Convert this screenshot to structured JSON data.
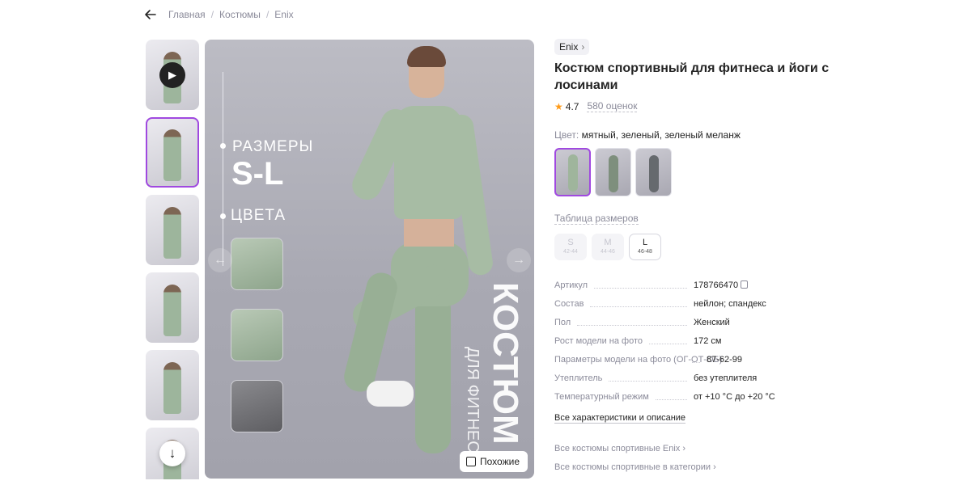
{
  "breadcrumbs": [
    "Главная",
    "Костюмы",
    "Enix"
  ],
  "gallery": {
    "hero_texts": {
      "sizes_label": "РАЗМЕРЫ",
      "sizes_value": "S-L",
      "colors_label": "ЦВЕТА",
      "vertical_big": "КОСТЮМ",
      "vertical_small": "ДЛЯ ФИТНЕС"
    },
    "similar_label": "Похожие"
  },
  "product": {
    "brand": "Enix",
    "title": "Костюм спортивный для фитнеса и йоги с лосинами",
    "rating": "4.7",
    "reviews": "580 оценок",
    "color_key": "Цвет:",
    "color_value": "мятный, зеленый, зеленый меланж",
    "size_table_link": "Таблица размеров",
    "sizes": [
      {
        "size": "S",
        "range": "42-44",
        "available": false
      },
      {
        "size": "M",
        "range": "44-46",
        "available": false
      },
      {
        "size": "L",
        "range": "46-48",
        "available": true
      }
    ],
    "specs": [
      {
        "key": "Артикул",
        "value": "178766470"
      },
      {
        "key": "Состав",
        "value": "нейлон; спандекс"
      },
      {
        "key": "Пол",
        "value": "Женский"
      },
      {
        "key": "Рост модели на фото",
        "value": "172 см"
      },
      {
        "key": "Параметры модели на фото (ОГ-ОТ-ОБ)",
        "value": "87-62-99"
      },
      {
        "key": "Утеплитель",
        "value": "без утеплителя"
      },
      {
        "key": "Температурный режим",
        "value": "от +10 °C до +20 °C"
      }
    ],
    "all_specs_link": "Все характеристики и описание",
    "links": [
      "Все костюмы спортивные Enix",
      "Все костюмы спортивные в категории"
    ]
  },
  "colors": {
    "accent": "#a049e0",
    "star": "#ff9a17",
    "muted": "#8b8b9a"
  }
}
